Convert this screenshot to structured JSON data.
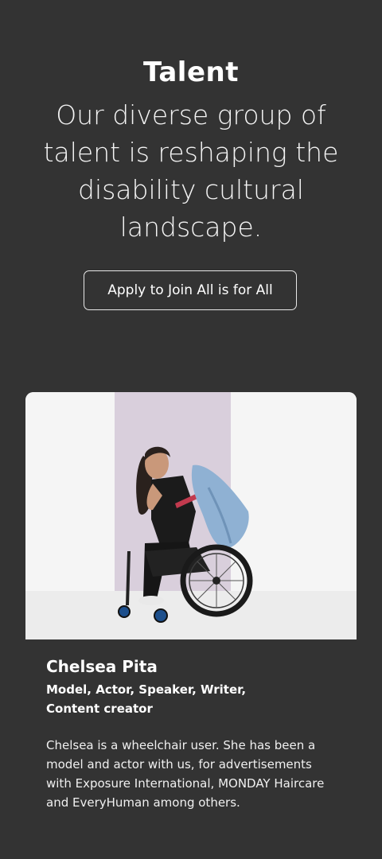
{
  "header": {
    "title": "Talent",
    "intro": "Our diverse group of talent is reshaping the disability cultural landscape.",
    "apply_button_label": "Apply to Join All is for All"
  },
  "talent": {
    "name": "Chelsea Pita",
    "roles": "Model, Actor, Speaker, Writer, Content creator",
    "bio": "Chelsea is a wheelchair user. She has been a model and actor with us, for advertisements with Exposure International, MONDAY Haircare and EveryHuman among others."
  },
  "colors": {
    "background": "#333333",
    "text": "#ffffff",
    "photo_backdrop_accent": "#d9cfdc"
  }
}
